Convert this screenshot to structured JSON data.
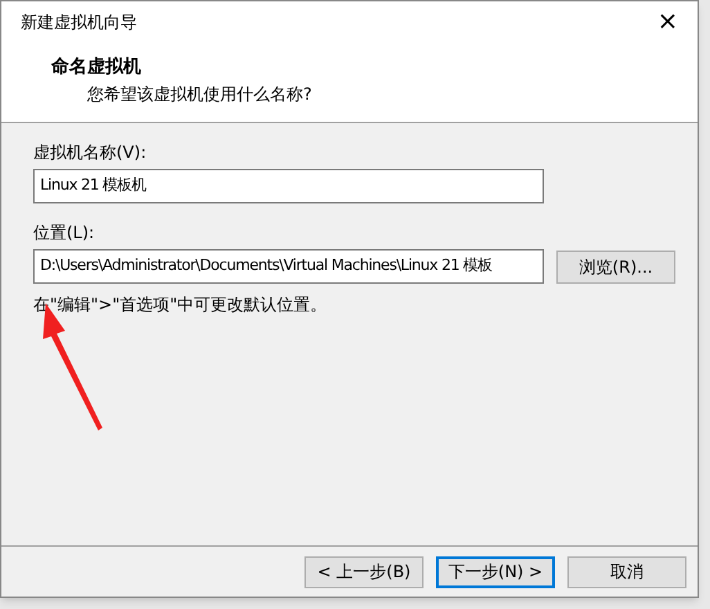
{
  "window": {
    "title": "新建虚拟机向导",
    "close": "×"
  },
  "header": {
    "title": "命名虚拟机",
    "subtitle": "您希望该虚拟机使用什么名称?"
  },
  "fields": [
    {
      "label": "虚拟机名称(V):",
      "value": "Linux 21 模板机"
    },
    {
      "label": "位置(L):",
      "value": "D:\\Users\\Administrator\\Documents\\Virtual Machines\\Linux 21 模板",
      "button": "浏览(R)..."
    }
  ],
  "hint": "在\"编辑\">\"首选项\"中可更改默认位置。",
  "buttons": [
    {
      "label": "< 上一步(B)",
      "focused": false
    },
    {
      "label": "下一步(N) >",
      "focused": true
    },
    {
      "label": "取消",
      "focused": false
    }
  ]
}
